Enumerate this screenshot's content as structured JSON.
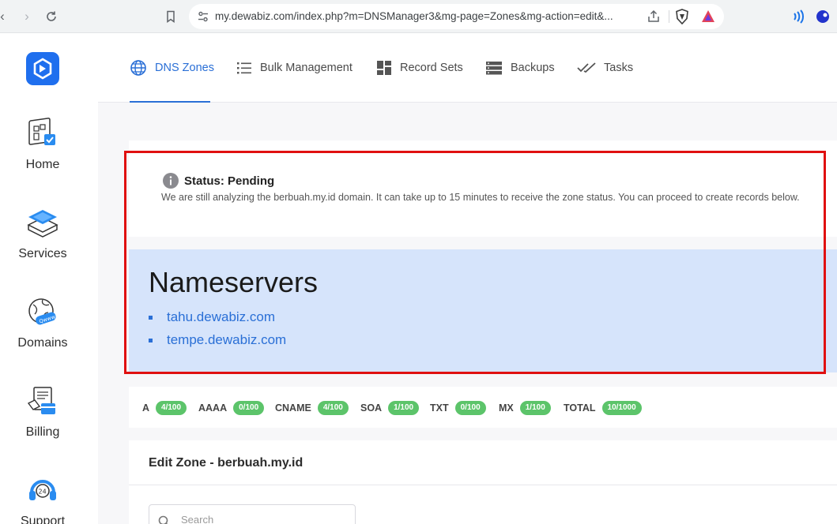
{
  "browser": {
    "url": "my.dewabiz.com/index.php?m=DNSManager3&mg-page=Zones&mg-action=edit&..."
  },
  "sidebar": {
    "items": [
      {
        "label": "Home",
        "icon": "home-icon"
      },
      {
        "label": "Services",
        "icon": "services-icon"
      },
      {
        "label": "Domains",
        "icon": "domains-icon"
      },
      {
        "label": "Billing",
        "icon": "billing-icon"
      },
      {
        "label": "Support",
        "icon": "support-icon"
      }
    ]
  },
  "tabs": [
    {
      "label": "DNS Zones",
      "icon": "globe-icon",
      "active": true
    },
    {
      "label": "Bulk Management",
      "icon": "list-icon"
    },
    {
      "label": "Record Sets",
      "icon": "grid-icon"
    },
    {
      "label": "Backups",
      "icon": "backups-icon"
    },
    {
      "label": "Tasks",
      "icon": "tasks-icon"
    }
  ],
  "status": {
    "title": "Status: Pending",
    "message": "We are still analyzing the berbuah.my.id domain. It can take up to 15 minutes to receive the zone status. You can proceed to create records below."
  },
  "nameservers": {
    "title": "Nameservers",
    "items": [
      "tahu.dewabiz.com",
      "tempe.dewabiz.com"
    ]
  },
  "record_counts": [
    {
      "type": "A",
      "count": "4/100"
    },
    {
      "type": "AAAA",
      "count": "0/100"
    },
    {
      "type": "CNAME",
      "count": "4/100"
    },
    {
      "type": "SOA",
      "count": "1/100"
    },
    {
      "type": "TXT",
      "count": "0/100"
    },
    {
      "type": "MX",
      "count": "1/100"
    },
    {
      "type": "TOTAL",
      "count": "10/1000"
    }
  ],
  "edit_zone": {
    "title": "Edit Zone - berbuah.my.id",
    "search_placeholder": "Search"
  },
  "colors": {
    "accent": "#2a6fd6",
    "pill_green": "#5cc46a",
    "highlight_red": "#e01010",
    "ns_panel": "#d6e4fb"
  }
}
